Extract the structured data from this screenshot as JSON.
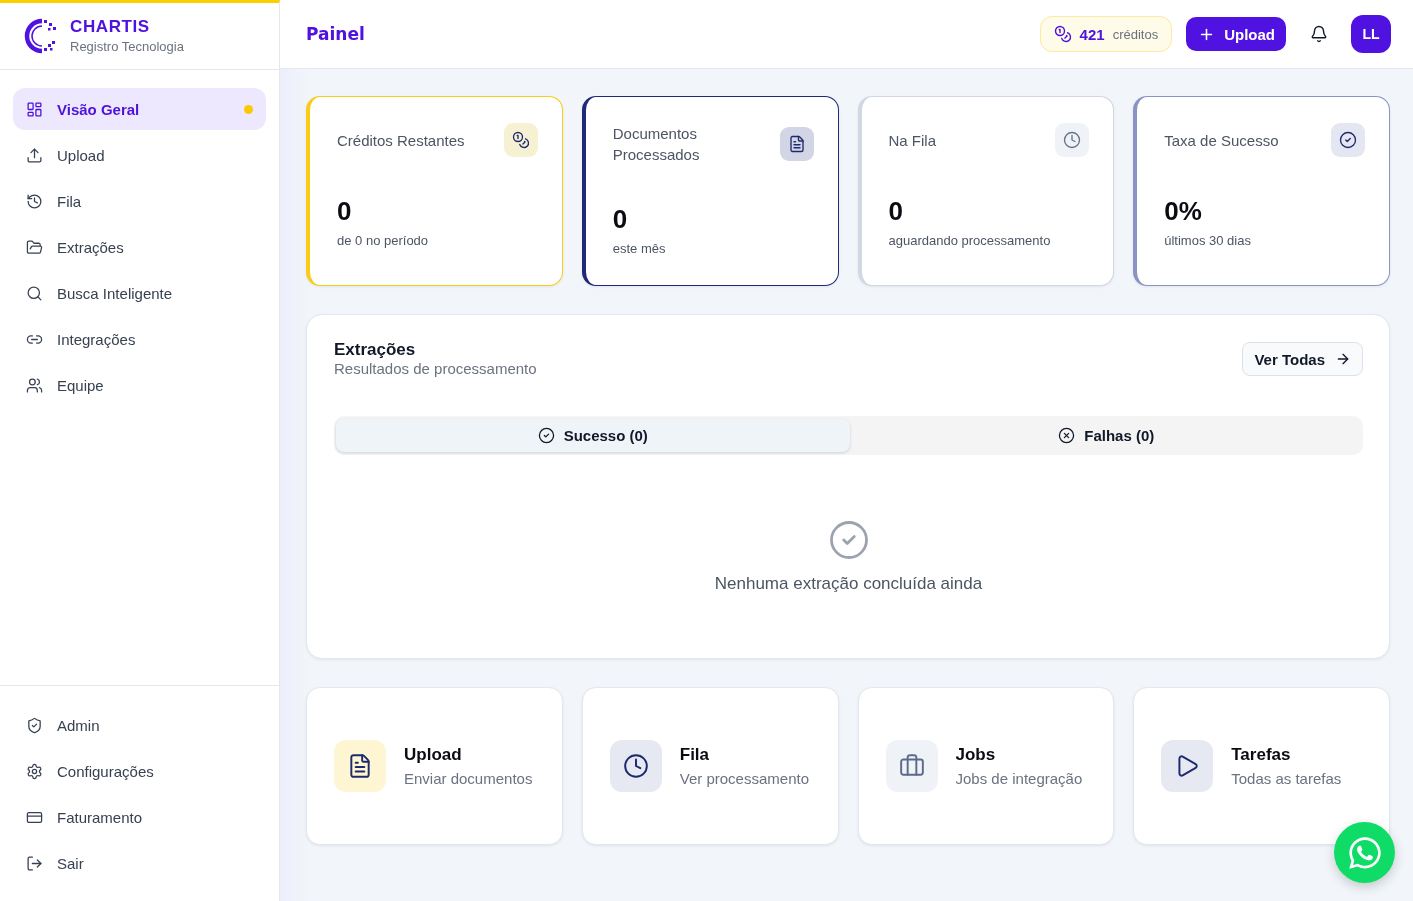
{
  "sidebar": {
    "brand": {
      "name": "CHARTIS",
      "tagline": "Registro Tecnologia"
    },
    "nav": [
      {
        "label": "Visão Geral",
        "selected": true
      },
      {
        "label": "Upload",
        "selected": false
      },
      {
        "label": "Fila",
        "selected": false
      },
      {
        "label": "Extrações",
        "selected": false
      },
      {
        "label": "Busca Inteligente",
        "selected": false
      },
      {
        "label": "Integrações",
        "selected": false
      },
      {
        "label": "Equipe",
        "selected": false
      }
    ],
    "footer_nav": [
      {
        "label": "Admin",
        "selected": false
      },
      {
        "label": "Configurações",
        "selected": false
      },
      {
        "label": "Faturamento",
        "selected": false
      },
      {
        "label": "Sair",
        "selected": false
      }
    ]
  },
  "header": {
    "title": "Painel",
    "credits": {
      "count": "421",
      "label": "créditos"
    },
    "upload_button": "Upload",
    "avatar": "LL"
  },
  "stats": [
    {
      "title": "Créditos Restantes",
      "value": "0",
      "note": "de 0 no período",
      "color": "#facc15"
    },
    {
      "title": "Documentos Processados",
      "value": "0",
      "note": "este mês",
      "color": "#1e2a78"
    },
    {
      "title": "Na Fila",
      "value": "0",
      "note": "aguardando processamento",
      "color": "#cfd8e3"
    },
    {
      "title": "Taxa de Sucesso",
      "value": "0%",
      "note": "últimos 30 dias",
      "color": "#8b93c4"
    }
  ],
  "extractions": {
    "title": "Extrações",
    "subtitle": "Resultados de processamento",
    "view_all": "Ver Todas",
    "tabs": [
      {
        "label": "Sucesso (0)",
        "selected": true
      },
      {
        "label": "Falhas (0)",
        "selected": false
      }
    ],
    "empty_message": "Nenhuma extração concluída ainda"
  },
  "shortcuts": [
    {
      "title": "Upload",
      "subtitle": "Enviar documentos",
      "color": "#fef6d3"
    },
    {
      "title": "Fila",
      "subtitle": "Ver processamento",
      "color": "#e6e9f2"
    },
    {
      "title": "Jobs",
      "subtitle": "Jobs de integração",
      "color": "#eff3f8"
    },
    {
      "title": "Tarefas",
      "subtitle": "Todas as tarefas",
      "color": "#e6e9f2"
    }
  ]
}
